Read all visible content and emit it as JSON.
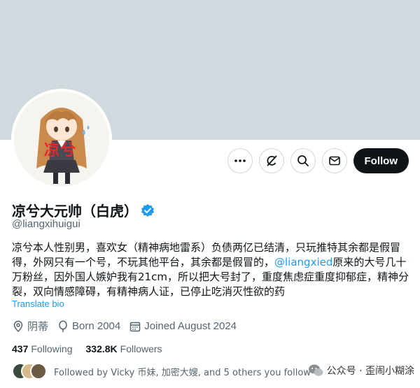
{
  "profile": {
    "avatar_text": "凉兮",
    "display_name": "凉兮大元帅（白虎）",
    "handle": "@liangxihuigui",
    "bio_part1": "凉兮本人性别男，喜欢女（精神病地雷系）负债两亿已结清，只玩推特其余都是假冒得，外网只有一个号，不玩其他平台，其余都是假冒的，",
    "bio_mention": "@liangxied",
    "bio_part2": "原来的大号几十万粉丝，因外国人嫉妒我有21cm，所以把大号封了，重度焦虑症重度抑郁症，精神分裂，双向情感障碍，有精神病人证，已停止吃消灭性欲的药",
    "translate_label": "Translate bio",
    "location": "阴蒂",
    "born": "Born 2004",
    "joined": "Joined August 2024",
    "following_count": "437",
    "following_label": "Following",
    "followers_count": "332.8K",
    "followers_label": "Followers",
    "followed_by": "Followed by Vicky 币妹, 加密大嫂, and 5 others you follow"
  },
  "actions": {
    "more_icon": "more-icon",
    "grok_icon": "grok-icon",
    "search_icon": "search-icon",
    "message_icon": "envelope-icon",
    "follow_label": "Follow"
  },
  "watermark": {
    "text": "公众号 · 歪闹小糊涂"
  },
  "colors": {
    "accent": "#1d9bf0",
    "banner": "#cfd9de",
    "text_primary": "#0f1419",
    "text_secondary": "#536471",
    "follow_bg": "#0f1419"
  }
}
